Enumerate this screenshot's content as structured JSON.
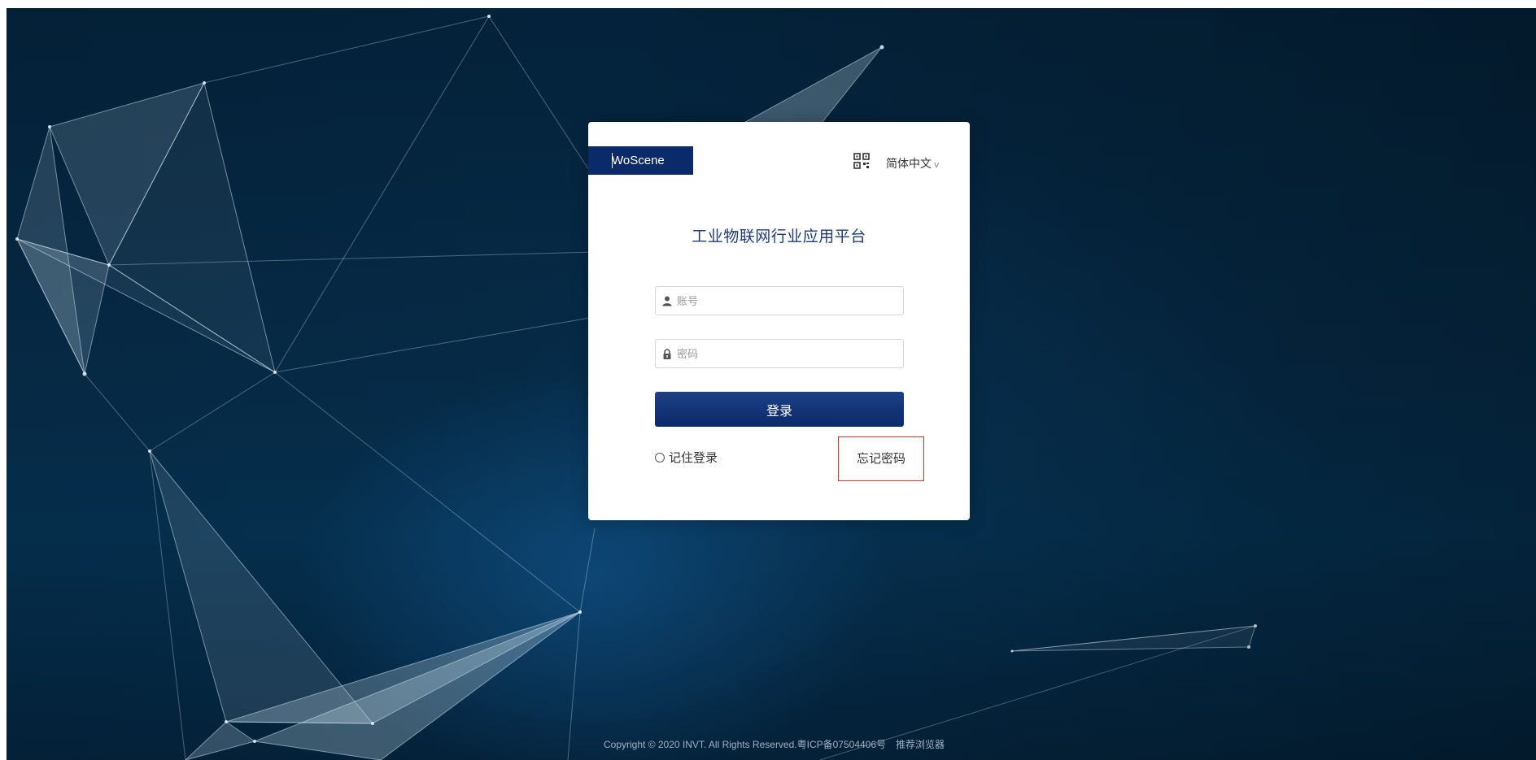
{
  "brand": {
    "logo_text": "WoScene"
  },
  "header": {
    "qr_icon": "qr-code-icon",
    "language_label": "简体中文",
    "language_chevron": "v"
  },
  "title": "工业物联网行业应用平台",
  "form": {
    "username_placeholder": "账号",
    "password_placeholder": "密码",
    "username_icon": "user-icon",
    "password_icon": "lock-icon",
    "login_label": "登录",
    "remember_label": "记住登录",
    "forgot_label": "忘记密码"
  },
  "footer": {
    "copyright": "Copyright © 2020 INVT. All Rights Reserved.粤ICP备07504406号",
    "browser_link": "推荐浏览器"
  },
  "colors": {
    "brand": "#0b2a6a",
    "title": "#1e3b78",
    "highlight_border": "#d9342b"
  }
}
